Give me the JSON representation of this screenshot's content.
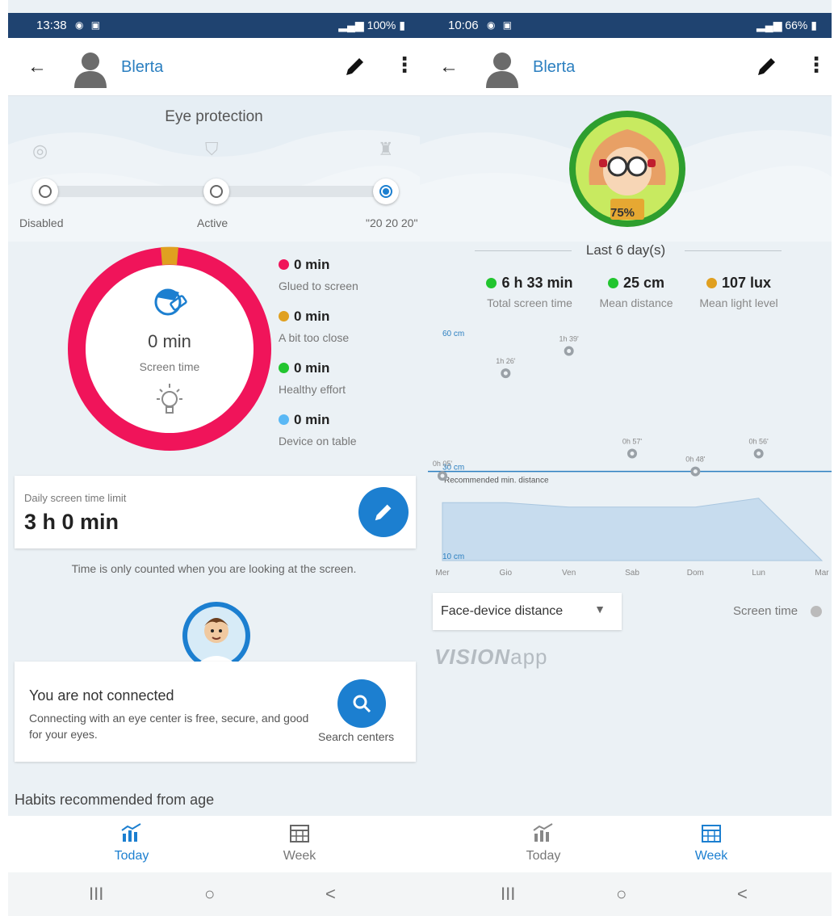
{
  "left": {
    "status": {
      "time": "13:38",
      "right": "100%",
      "icons": "◉ ▣"
    },
    "header": {
      "back_icon": "←",
      "user_name": "Blerta",
      "more_icon": "⋮"
    },
    "eye_protection": {
      "title": "Eye protection",
      "options": [
        "Disabled",
        "Active",
        "\"20 20 20\""
      ],
      "selected": 2
    },
    "screen_time": {
      "value": "0 min",
      "label": "Screen time",
      "legend": [
        {
          "value": "0 min",
          "label": "Glued to screen",
          "color": "#f0145a"
        },
        {
          "value": "0 min",
          "label": "A bit too close",
          "color": "#e0a020"
        },
        {
          "value": "0 min",
          "label": "Healthy effort",
          "color": "#22c52f"
        },
        {
          "value": "0 min",
          "label": "Device on table",
          "color": "#5ab8f5"
        }
      ]
    },
    "limit": {
      "title": "Daily screen time limit",
      "value": "3 h 0 min"
    },
    "note": "Time is only counted when you are looking at the screen.",
    "connection": {
      "title": "You are not connected",
      "description": "Connecting with an eye center is free, secure, and good for your eyes.",
      "search_label": "Search centers"
    },
    "habits_title": "Habits recommended from age",
    "nav": {
      "today": "Today",
      "week": "Week",
      "active": "today"
    }
  },
  "right": {
    "status": {
      "time": "10:06",
      "right": "66%",
      "icons": "◉ ▣"
    },
    "header": {
      "back_icon": "←",
      "user_name": "Blerta",
      "more_icon": "⋮"
    },
    "badge_percent": "75%",
    "period": "Last 6 day(s)",
    "stats": [
      {
        "value": "6 h 33 min",
        "label": "Total screen time",
        "color": "#22c52f"
      },
      {
        "value": "25 cm",
        "label": "Mean distance",
        "color": "#22c52f"
      },
      {
        "value": "107 lux",
        "label": "Mean light level",
        "color": "#e0a020"
      }
    ],
    "dropdown": {
      "value": "Face-device distance",
      "caret": "▼"
    },
    "toggle_label": "Screen time",
    "brand": {
      "bold": "VISION",
      "light": "app"
    },
    "nav": {
      "today": "Today",
      "week": "Week",
      "active": "week"
    }
  },
  "system_nav": {
    "recents": "III",
    "home": "○",
    "back": "<"
  },
  "chart_data": {
    "type": "area",
    "categories": [
      "Mer",
      "Gio",
      "Ven",
      "Sab",
      "Dom",
      "Lun",
      "Mar"
    ],
    "y_labels": [
      "60 cm",
      "30 cm",
      "10 cm"
    ],
    "recommended_label": "Recommended min. distance",
    "recommended_value": 30,
    "ylim": [
      10,
      60
    ],
    "distance_values": [
      23,
      23,
      22,
      22,
      22,
      24,
      10
    ],
    "screen_time_points": [
      {
        "category": "Mer",
        "label": "0h 05'",
        "value": 29
      },
      {
        "category": "Gio",
        "label": "1h 26'",
        "value": 52
      },
      {
        "category": "Ven",
        "label": "1h 39'",
        "value": 57
      },
      {
        "category": "Sab",
        "label": "0h 57'",
        "value": 34
      },
      {
        "category": "Dom",
        "label": "0h 48'",
        "value": 30
      },
      {
        "category": "Lun",
        "label": "0h 56'",
        "value": 34
      }
    ],
    "area_color": "#c7dcee",
    "line_color": "#2b7fc0"
  }
}
